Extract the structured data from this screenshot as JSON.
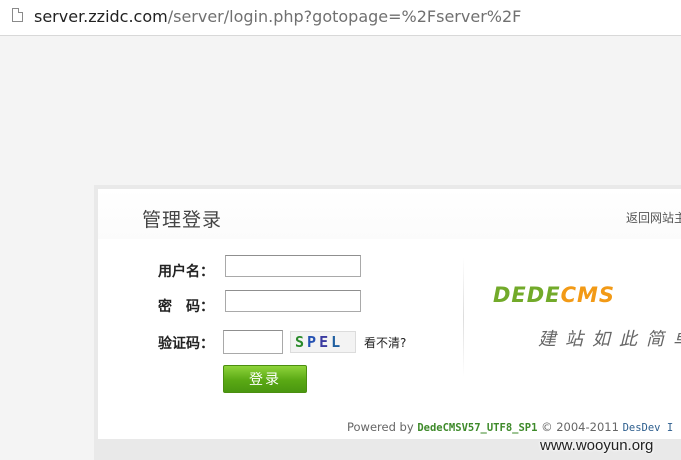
{
  "browser": {
    "url_host": "server.zzidc.com",
    "url_path": "/server/login.php?gotopage=%2Fserver%2F"
  },
  "panel": {
    "title": "管理登录",
    "back_link": "返回网站主"
  },
  "form": {
    "username_label": "用户名：",
    "password_label": "密　码：",
    "captcha_label": "验证码：",
    "username_value": "",
    "password_value": "",
    "captcha_value": "",
    "captcha_chars": [
      "S",
      "P",
      "E",
      "L"
    ],
    "refresh_label": "看不清?",
    "login_label": "登录"
  },
  "brand": {
    "logo_dede": "DEDE",
    "logo_cms": "CMS",
    "slogan": "建站如此简单"
  },
  "footer": {
    "powered_prefix": "Powered by",
    "version": "DedeCMSV57_UTF8_SP1",
    "copyright": "© 2004-2011",
    "dev": "DesDev I"
  },
  "watermark": "www.wooyun.org",
  "colors": {
    "accent_green": "#5aa914",
    "logo_orange": "#f29a16"
  }
}
